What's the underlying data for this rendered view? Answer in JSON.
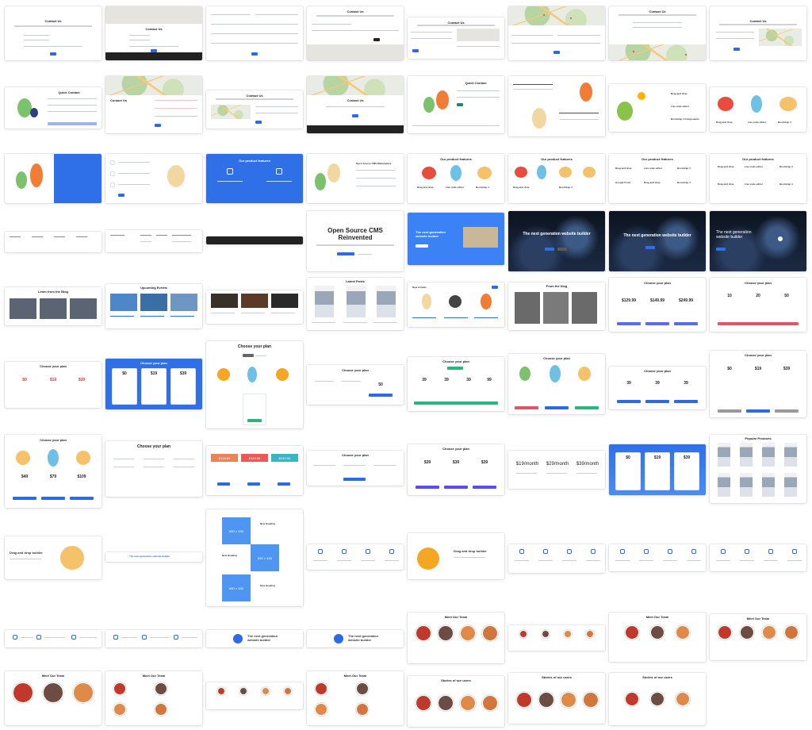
{
  "cards": {
    "contact_us": "Contact Us",
    "quick_contact": "Quick Contact",
    "open_source_cms": "Open Source CMS\nReinvented",
    "next_gen_builder": "The next generation website builder",
    "next_gen_builder_short": "The next generation\nwebsite builder",
    "our_product_features": "Our product features",
    "choose_your_plan": "Choose your plan",
    "latest_posts": "Latest Posts",
    "from_the_blog": "From the blog",
    "learn_from_blog": "Learn from the Blog",
    "upcoming_events": "Upcoming Events",
    "meet_our_team": "Meet Our Team",
    "stories_of_our_users": "Stories of our users",
    "popular_products": "Popular Products",
    "drag_and_drop": "Drag and drop builder",
    "new_heading": "New Heading",
    "placeholder_box": "650 × 450",
    "prices_a": [
      "$19/month",
      "$29/month",
      "$39/month"
    ],
    "prices_b": [
      "$49",
      "$79",
      "$109"
    ],
    "prices_c": [
      "$0",
      "$19",
      "$39"
    ],
    "prices_d": [
      "$129.99",
      "$149.99",
      "$249.99"
    ],
    "prices_e": [
      "10",
      "20",
      "50"
    ],
    "prices_f": [
      "39",
      "39",
      "99"
    ],
    "open_source_cms_marketplace": "Open Source CMS Marketplace"
  }
}
